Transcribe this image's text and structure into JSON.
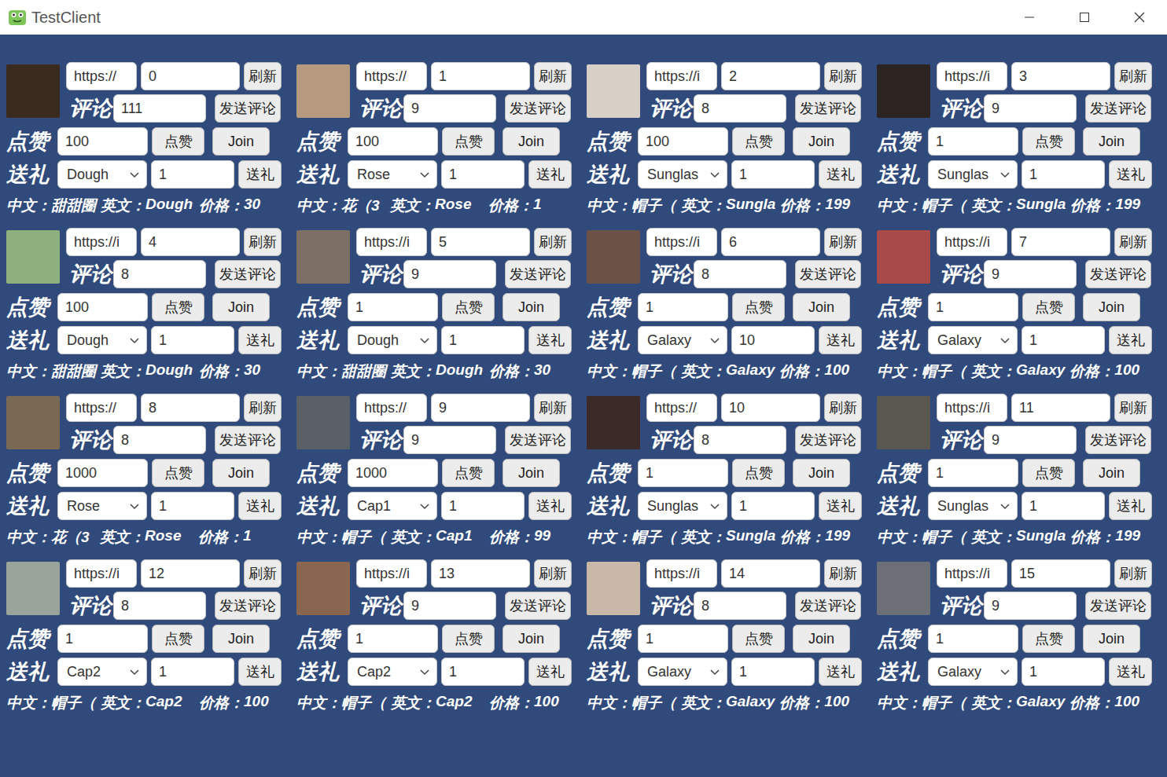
{
  "window": {
    "title": "TestClient"
  },
  "labels": {
    "refresh": "刷新",
    "comment": "评论",
    "send_comment": "发送评论",
    "like_label": "点赞",
    "like_button": "点赞",
    "join": "Join",
    "gift_label": "送礼",
    "gift_button": "送礼",
    "cn": "中文：",
    "en": "英文：",
    "price": "价格："
  },
  "cards": [
    {
      "url": "https://",
      "room": "0",
      "comment": "111",
      "likes": "100",
      "gift": "Dough",
      "gift_count": "1",
      "cn": "甜甜圈",
      "en": "Dough",
      "price": "30"
    },
    {
      "url": "https://",
      "room": "1",
      "comment": "9",
      "likes": "100",
      "gift": "Rose",
      "gift_count": "1",
      "cn": "花（3",
      "en": "Rose",
      "price": "1"
    },
    {
      "url": "https://i",
      "room": "2",
      "comment": "8",
      "likes": "100",
      "gift": "Sunglas",
      "gift_count": "1",
      "cn": "帽子（",
      "en": "Sungla",
      "price": "199"
    },
    {
      "url": "https://i",
      "room": "3",
      "comment": "9",
      "likes": "1",
      "gift": "Sunglas",
      "gift_count": "1",
      "cn": "帽子（",
      "en": "Sungla",
      "price": "199"
    },
    {
      "url": "https://i",
      "room": "4",
      "comment": "8",
      "likes": "100",
      "gift": "Dough",
      "gift_count": "1",
      "cn": "甜甜圈",
      "en": "Dough",
      "price": "30"
    },
    {
      "url": "https://i",
      "room": "5",
      "comment": "9",
      "likes": "1",
      "gift": "Dough",
      "gift_count": "1",
      "cn": "甜甜圈",
      "en": "Dough",
      "price": "30"
    },
    {
      "url": "https://i",
      "room": "6",
      "comment": "8",
      "likes": "1",
      "gift": "Galaxy",
      "gift_count": "10",
      "cn": "帽子（",
      "en": "Galaxy",
      "price": "100"
    },
    {
      "url": "https://i",
      "room": "7",
      "comment": "9",
      "likes": "1",
      "gift": "Galaxy",
      "gift_count": "1",
      "cn": "帽子（",
      "en": "Galaxy",
      "price": "100"
    },
    {
      "url": "https://",
      "room": "8",
      "comment": "8",
      "likes": "1000",
      "gift": "Rose",
      "gift_count": "1",
      "cn": "花（3",
      "en": "Rose",
      "price": "1"
    },
    {
      "url": "https://",
      "room": "9",
      "comment": "9",
      "likes": "1000",
      "gift": "Cap1",
      "gift_count": "1",
      "cn": "帽子（",
      "en": "Cap1",
      "price": "99"
    },
    {
      "url": "https://",
      "room": "10",
      "comment": "8",
      "likes": "1",
      "gift": "Sunglas",
      "gift_count": "1",
      "cn": "帽子（",
      "en": "Sungla",
      "price": "199"
    },
    {
      "url": "https://i",
      "room": "11",
      "comment": "9",
      "likes": "1",
      "gift": "Sunglas",
      "gift_count": "1",
      "cn": "帽子（",
      "en": "Sungla",
      "price": "199"
    },
    {
      "url": "https://i",
      "room": "12",
      "comment": "8",
      "likes": "1",
      "gift": "Cap2",
      "gift_count": "1",
      "cn": "帽子（",
      "en": "Cap2",
      "price": "100"
    },
    {
      "url": "https://i",
      "room": "13",
      "comment": "9",
      "likes": "1",
      "gift": "Cap2",
      "gift_count": "1",
      "cn": "帽子（",
      "en": "Cap2",
      "price": "100"
    },
    {
      "url": "https://i",
      "room": "14",
      "comment": "8",
      "likes": "1",
      "gift": "Galaxy",
      "gift_count": "1",
      "cn": "帽子（",
      "en": "Galaxy",
      "price": "100"
    },
    {
      "url": "https://i",
      "room": "15",
      "comment": "9",
      "likes": "1",
      "gift": "Galaxy",
      "gift_count": "1",
      "cn": "帽子（",
      "en": "Galaxy",
      "price": "100"
    }
  ]
}
